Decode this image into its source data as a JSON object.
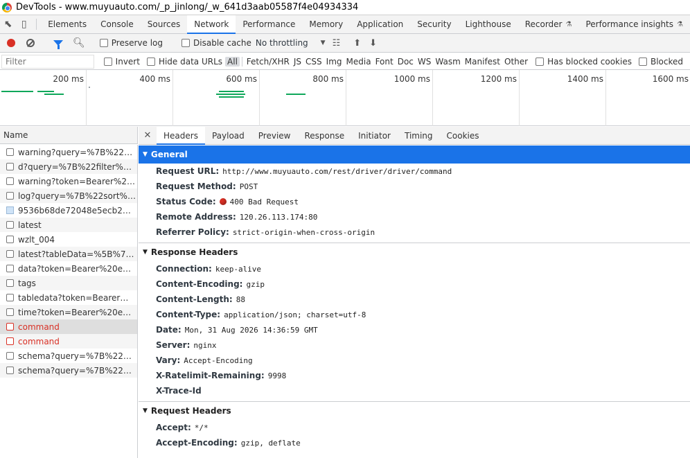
{
  "window": {
    "title": "DevTools - www.muyuauto.com/_p_jinlong/_w_641d3aab05587f4e04934334"
  },
  "tabs": [
    {
      "label": "Elements",
      "w": 1
    },
    {
      "label": "Console",
      "w": 1
    },
    {
      "label": "Sources",
      "w": 1
    },
    {
      "label": "Network",
      "w": 1
    },
    {
      "label": "Performance",
      "w": 1
    },
    {
      "label": "Memory",
      "w": 1
    },
    {
      "label": "Application",
      "w": 1
    },
    {
      "label": "Security",
      "w": 1
    },
    {
      "label": "Lighthouse",
      "w": 1
    },
    {
      "label": "Recorder",
      "w": 1
    },
    {
      "label": "Performance insights",
      "w": 1
    }
  ],
  "toolbar": {
    "preserve_log": "Preserve log",
    "disable_cache": "Disable cache",
    "throttling": "No throttling"
  },
  "filter": {
    "placeholder": "Filter",
    "invert": "Invert",
    "hide_data_urls": "Hide data URLs",
    "types": [
      "All",
      "Fetch/XHR",
      "JS",
      "CSS",
      "Img",
      "Media",
      "Font",
      "Doc",
      "WS",
      "Wasm",
      "Manifest",
      "Other"
    ],
    "has_blocked_cookies": "Has blocked cookies",
    "blocked": "Blocked"
  },
  "overview": {
    "ticks": [
      "200 ms",
      "400 ms",
      "600 ms",
      "800 ms",
      "1000 ms",
      "1200 ms",
      "1400 ms",
      "1600 ms"
    ]
  },
  "requests": {
    "header": "Name",
    "items": [
      {
        "name": "warning?query=%7B%22sort%22...",
        "status": "ok"
      },
      {
        "name": "d?query=%7B%22filter%22%...",
        "status": "ok"
      },
      {
        "name": "warning?token=Bearer%20eyJ...",
        "status": "ok"
      },
      {
        "name": "log?query=%7B%22sort%22...",
        "status": "ok"
      },
      {
        "name": "9536b68de72048e5ecb24be8...",
        "status": "image"
      },
      {
        "name": "latest",
        "status": "ok"
      },
      {
        "name": "wzlt_004",
        "status": "ok"
      },
      {
        "name": "latest?tableData=%5B%7B%2...",
        "status": "ok"
      },
      {
        "name": "data?token=Bearer%20eyJhb...",
        "status": "ok"
      },
      {
        "name": "tags",
        "status": "ok"
      },
      {
        "name": "tabledata?token=Bearer%20e...",
        "status": "ok"
      },
      {
        "name": "time?token=Bearer%20eyJhb...",
        "status": "ok"
      },
      {
        "name": "command",
        "status": "error"
      },
      {
        "name": "command",
        "status": "error"
      },
      {
        "name": "schema?query=%7B%22proje...",
        "status": "ok"
      },
      {
        "name": "schema?query=%7B%22proje...",
        "status": "ok"
      }
    ]
  },
  "detail_tabs": [
    "Headers",
    "Payload",
    "Preview",
    "Response",
    "Initiator",
    "Timing",
    "Cookies"
  ],
  "general": {
    "title": "General",
    "rows": [
      {
        "key": "Request URL:",
        "value": "http://www.muyuauto.com/rest/driver/driver/command"
      },
      {
        "key": "Request Method:",
        "value": "POST"
      },
      {
        "key": "Status Code:",
        "value": "400 Bad Request"
      },
      {
        "key": "Remote Address:",
        "value": "120.26.113.174:80"
      },
      {
        "key": "Referrer Policy:",
        "value": "strict-origin-when-cross-origin"
      }
    ]
  },
  "response_headers": {
    "title": "Response Headers",
    "rows": [
      {
        "key": "Connection:",
        "value": "keep-alive"
      },
      {
        "key": "Content-Encoding:",
        "value": "gzip"
      },
      {
        "key": "Content-Length:",
        "value": "88"
      },
      {
        "key": "Content-Type:",
        "value": "application/json; charset=utf-8"
      },
      {
        "key": "Date:",
        "value": "Mon, 31 Aug 2026 14:36:59 GMT"
      },
      {
        "key": "Server:",
        "value": "nginx"
      },
      {
        "key": "Vary:",
        "value": "Accept-Encoding"
      },
      {
        "key": "X-Ratelimit-Remaining:",
        "value": "9998"
      },
      {
        "key": "X-Trace-Id",
        "value": ""
      }
    ]
  },
  "request_headers": {
    "title": "Request Headers",
    "rows": [
      {
        "key": "Accept:",
        "value": "*/*"
      },
      {
        "key": "Accept-Encoding:",
        "value": "gzip, deflate"
      }
    ]
  },
  "colors": {
    "accent": "#1a73e8",
    "error": "#d93025",
    "bar": "#0fa75a"
  }
}
